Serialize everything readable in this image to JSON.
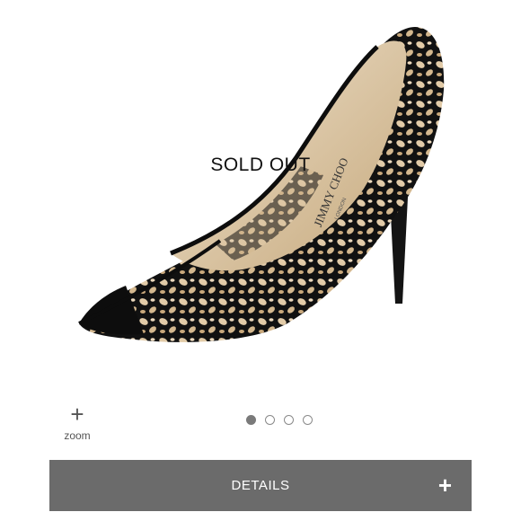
{
  "product": {
    "status_overlay": "SOLD OUT",
    "brand_on_insole": "JIMMY CHOO",
    "brand_sub_on_insole": "LONDON"
  },
  "gallery": {
    "zoom_icon": "plus-icon",
    "zoom_label": "zoom",
    "total_images": 4,
    "active_index": 0
  },
  "details": {
    "label": "DETAILS",
    "toggle_icon": "plus-icon"
  },
  "colors": {
    "details_bar": "#6b6b6b",
    "shoe_suede": "#111111",
    "shoe_lining": "#d9c3a6"
  }
}
